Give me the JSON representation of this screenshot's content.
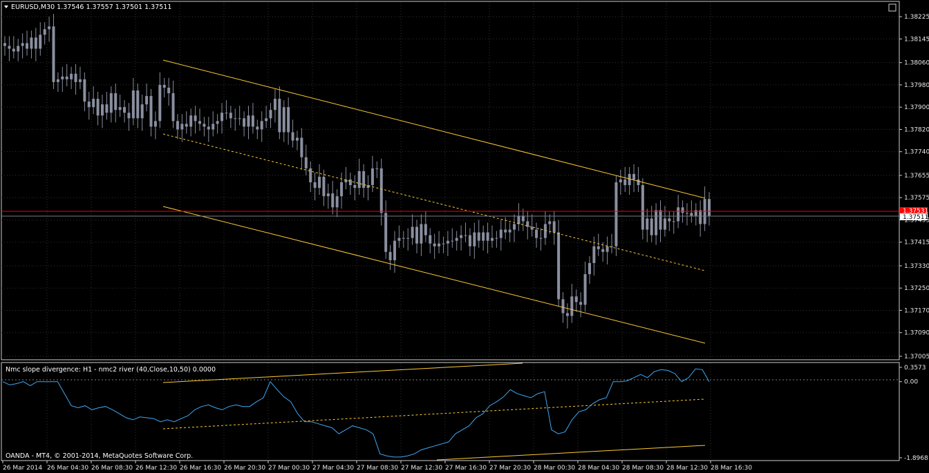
{
  "header": {
    "symbol_line": "EURUSD,M30  1.37546 1.37557 1.37501 1.37511"
  },
  "indicator": {
    "title": "Nmc slope divergence:  H1 - nmc2 river  (40,Close,10,50) 0.0000"
  },
  "footer": {
    "copyright": "OANDA - MT4, © 2001-2014, MetaQuotes Software Corp."
  },
  "colors": {
    "background": "#000000",
    "grid": "#3a3a3a",
    "candle": "#8a8fa0",
    "channel": "#ffcc33",
    "price_line": "#ff0000",
    "indicator_line": "#3fa9f5"
  },
  "chart_data": [
    {
      "type": "candlestick",
      "title": "EURUSD,M30",
      "y_ticks": [
        "1.38225",
        "1.38145",
        "1.38060",
        "1.37980",
        "1.37900",
        "1.37820",
        "1.37740",
        "1.37655",
        "1.37575",
        "1.37495",
        "1.37415",
        "1.37330",
        "1.37250",
        "1.37170",
        "1.37090",
        "1.37005"
      ],
      "ylim": [
        1.36995,
        1.38275
      ],
      "current_price": "1.37511",
      "current_price_marked": "1.37531",
      "x_ticks": [
        "26 Mar 2014",
        "26 Mar 04:30",
        "26 Mar 08:30",
        "26 Mar 12:30",
        "26 Mar 16:30",
        "26 Mar 20:30",
        "27 Mar 00:30",
        "27 Mar 04:30",
        "27 Mar 08:30",
        "27 Mar 12:30",
        "27 Mar 16:30",
        "27 Mar 20:30",
        "28 Mar 00:30",
        "28 Mar 04:30",
        "28 Mar 08:30",
        "28 Mar 12:30",
        "28 Mar 16:30"
      ],
      "grid": true,
      "closes": [
        1.3812,
        1.3811,
        1.381,
        1.3812,
        1.3813,
        1.3811,
        1.3815,
        1.3811,
        1.3816,
        1.3818,
        1.3819,
        1.3799,
        1.38,
        1.3801,
        1.38,
        1.3802,
        1.3799,
        1.38,
        1.3792,
        1.379,
        1.3793,
        1.3787,
        1.3791,
        1.3788,
        1.3795,
        1.3789,
        1.379,
        1.3788,
        1.3786,
        1.3796,
        1.3786,
        1.3791,
        1.3794,
        1.3783,
        1.3785,
        1.3798,
        1.3797,
        1.3795,
        1.3785,
        1.3782,
        1.3784,
        1.3783,
        1.3787,
        1.3785,
        1.3784,
        1.3783,
        1.3782,
        1.3784,
        1.3785,
        1.3788,
        1.3788,
        1.3786,
        1.3786,
        1.3786,
        1.3783,
        1.3787,
        1.3783,
        1.3782,
        1.3785,
        1.3786,
        1.3789,
        1.3793,
        1.3781,
        1.379,
        1.3781,
        1.3778,
        1.3779,
        1.3772,
        1.3768,
        1.3763,
        1.3761,
        1.3765,
        1.3758,
        1.3759,
        1.3754,
        1.3758,
        1.3763,
        1.3764,
        1.3762,
        1.3761,
        1.3767,
        1.3761,
        1.3762,
        1.3768,
        1.3768,
        1.3752,
        1.3738,
        1.3735,
        1.3742,
        1.3743,
        1.3743,
        1.3743,
        1.3747,
        1.3741,
        1.3748,
        1.3744,
        1.3741,
        1.374,
        1.3741,
        1.3741,
        1.3742,
        1.3742,
        1.3743,
        1.3744,
        1.3744,
        1.374,
        1.3745,
        1.3742,
        1.3745,
        1.3742,
        1.3743,
        1.3743,
        1.3746,
        1.3745,
        1.3746,
        1.3748,
        1.3751,
        1.3749,
        1.3747,
        1.3746,
        1.3743,
        1.3743,
        1.3748,
        1.3749,
        1.3745,
        1.3721,
        1.3716,
        1.3715,
        1.3722,
        1.372,
        1.3719,
        1.373,
        1.3734,
        1.374,
        1.3739,
        1.3738,
        1.374,
        1.374,
        1.3763,
        1.3764,
        1.3762,
        1.3766,
        1.3764,
        1.3762,
        1.3746,
        1.375,
        1.3744,
        1.3753,
        1.3746,
        1.375,
        1.3749,
        1.3749,
        1.3754,
        1.3752,
        1.3752,
        1.3751,
        1.3753,
        1.3748,
        1.3757,
        1.3751
      ]
    },
    {
      "type": "line",
      "title": "Nmc slope divergence:  H1 - nmc2 river  (40,Close,10,50) 0.0000",
      "y_ticks": [
        "0.3573",
        "0.00",
        "-1.8968"
      ],
      "ylim": [
        -1.95,
        0.46
      ],
      "grid": true,
      "series": [
        {
          "values": [
            0.0,
            -0.08,
            -0.05,
            0.0,
            -0.1,
            0.0,
            0.0,
            0.0,
            0.0,
            -0.3,
            -0.6,
            -0.65,
            -0.6,
            -0.7,
            -0.65,
            -0.62,
            -0.7,
            -0.8,
            -0.9,
            -0.95,
            -0.88,
            -0.9,
            -0.92,
            -1.0,
            -0.95,
            -1.0,
            -0.92,
            -0.85,
            -0.7,
            -0.62,
            -0.58,
            -0.65,
            -0.7,
            -0.62,
            -0.58,
            -0.62,
            -0.62,
            -0.5,
            -0.4,
            0.0,
            -0.2,
            -0.38,
            -0.5,
            -0.8,
            -1.0,
            -1.0,
            -1.05,
            -1.1,
            -1.15,
            -1.3,
            -1.2,
            -1.1,
            -1.15,
            -1.2,
            -1.3,
            -1.8,
            -1.85,
            -1.88,
            -1.88,
            -1.85,
            -1.8,
            -1.7,
            -1.65,
            -1.6,
            -1.55,
            -1.5,
            -1.3,
            -1.2,
            -1.1,
            -0.9,
            -0.8,
            -0.6,
            -0.5,
            -0.38,
            -0.2,
            -0.3,
            -0.35,
            -0.4,
            -0.3,
            -0.25,
            -1.2,
            -1.3,
            -1.25,
            -0.95,
            -0.75,
            -0.7,
            -0.55,
            -0.45,
            -0.4,
            0.0,
            0.0,
            0.02,
            0.1,
            0.18,
            0.1,
            0.25,
            0.3,
            0.28,
            0.2,
            0.0,
            0.1,
            0.32,
            0.3,
            0.0
          ]
        }
      ]
    }
  ]
}
